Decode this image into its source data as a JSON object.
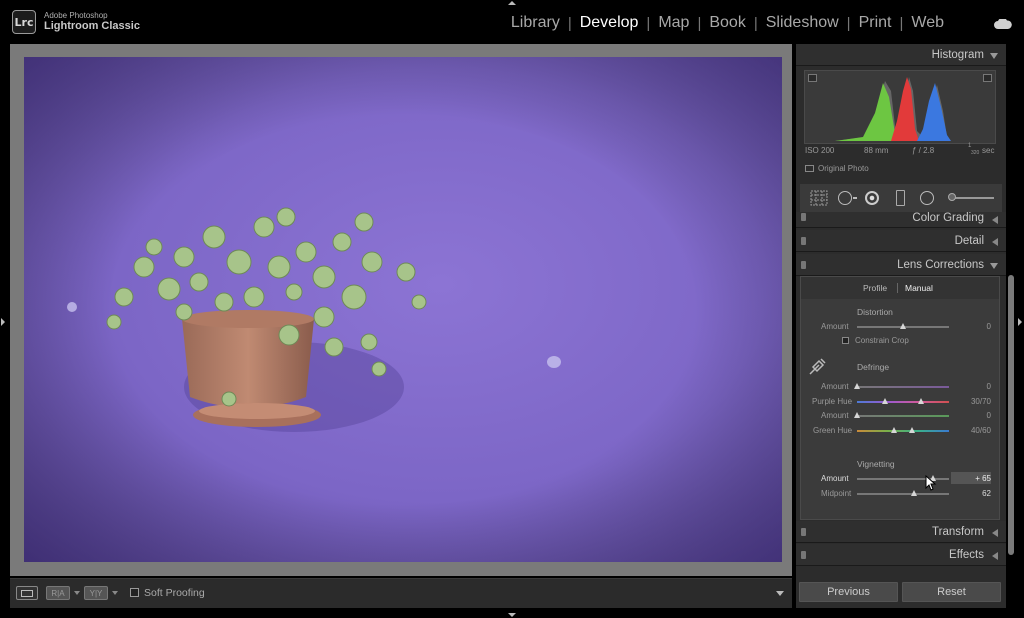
{
  "app": {
    "logo": "Lrc",
    "brand_line1": "Adobe Photoshop",
    "brand_line2": "Lightroom Classic"
  },
  "modules": [
    {
      "label": "Library",
      "active": false
    },
    {
      "label": "Develop",
      "active": true
    },
    {
      "label": "Map",
      "active": false
    },
    {
      "label": "Book",
      "active": false
    },
    {
      "label": "Slideshow",
      "active": false
    },
    {
      "label": "Print",
      "active": false
    },
    {
      "label": "Web",
      "active": false
    }
  ],
  "icons": {
    "cloud": "cloud-icon",
    "pointer": "mouse-pointer-icon",
    "eyedropper": "eyedropper-icon"
  },
  "toolbar": {
    "soft_proofing": "Soft Proofing",
    "view_buttons": [
      "R|A",
      "Y|Y"
    ]
  },
  "histogram": {
    "title": "Histogram",
    "iso": "ISO 200",
    "focal": "88 mm",
    "aperture": "ƒ / 2.8",
    "shutter_num": "1",
    "shutter_den": "320",
    "shutter_unit": "sec",
    "original_photo": "Original Photo"
  },
  "panels": {
    "color_grading": "Color Grading",
    "detail": "Detail",
    "lens_corrections": "Lens Corrections",
    "transform": "Transform",
    "effects": "Effects"
  },
  "lens": {
    "tabs": [
      "Profile",
      "Manual"
    ],
    "active_tab": "Manual",
    "distortion": {
      "section": "Distortion",
      "amount_label": "Amount",
      "amount": "0",
      "amount_frac": 0.5,
      "constrain_crop": "Constrain Crop"
    },
    "defringe": {
      "section": "Defringe",
      "purple_amount_label": "Amount",
      "purple_amount": "0",
      "purple_amount_frac": 0.0,
      "purple_hue_label": "Purple Hue",
      "purple_hue": "30/70",
      "purple_hue_lo": 0.3,
      "purple_hue_hi": 0.7,
      "green_amount_label": "Amount",
      "green_amount": "0",
      "green_amount_frac": 0.0,
      "green_hue_label": "Green Hue",
      "green_hue": "40/60",
      "green_hue_lo": 0.4,
      "green_hue_hi": 0.6
    },
    "vignetting": {
      "section": "Vignetting",
      "amount_label": "Amount",
      "amount": "+ 65",
      "amount_frac": 0.825,
      "midpoint_label": "Midpoint",
      "midpoint": "62",
      "midpoint_frac": 0.62
    }
  },
  "buttons": {
    "previous": "Previous",
    "reset": "Reset"
  },
  "colors": {
    "wall": "#7c66c6",
    "panel": "#2c2c2c",
    "accent_white": "#ffffff"
  }
}
